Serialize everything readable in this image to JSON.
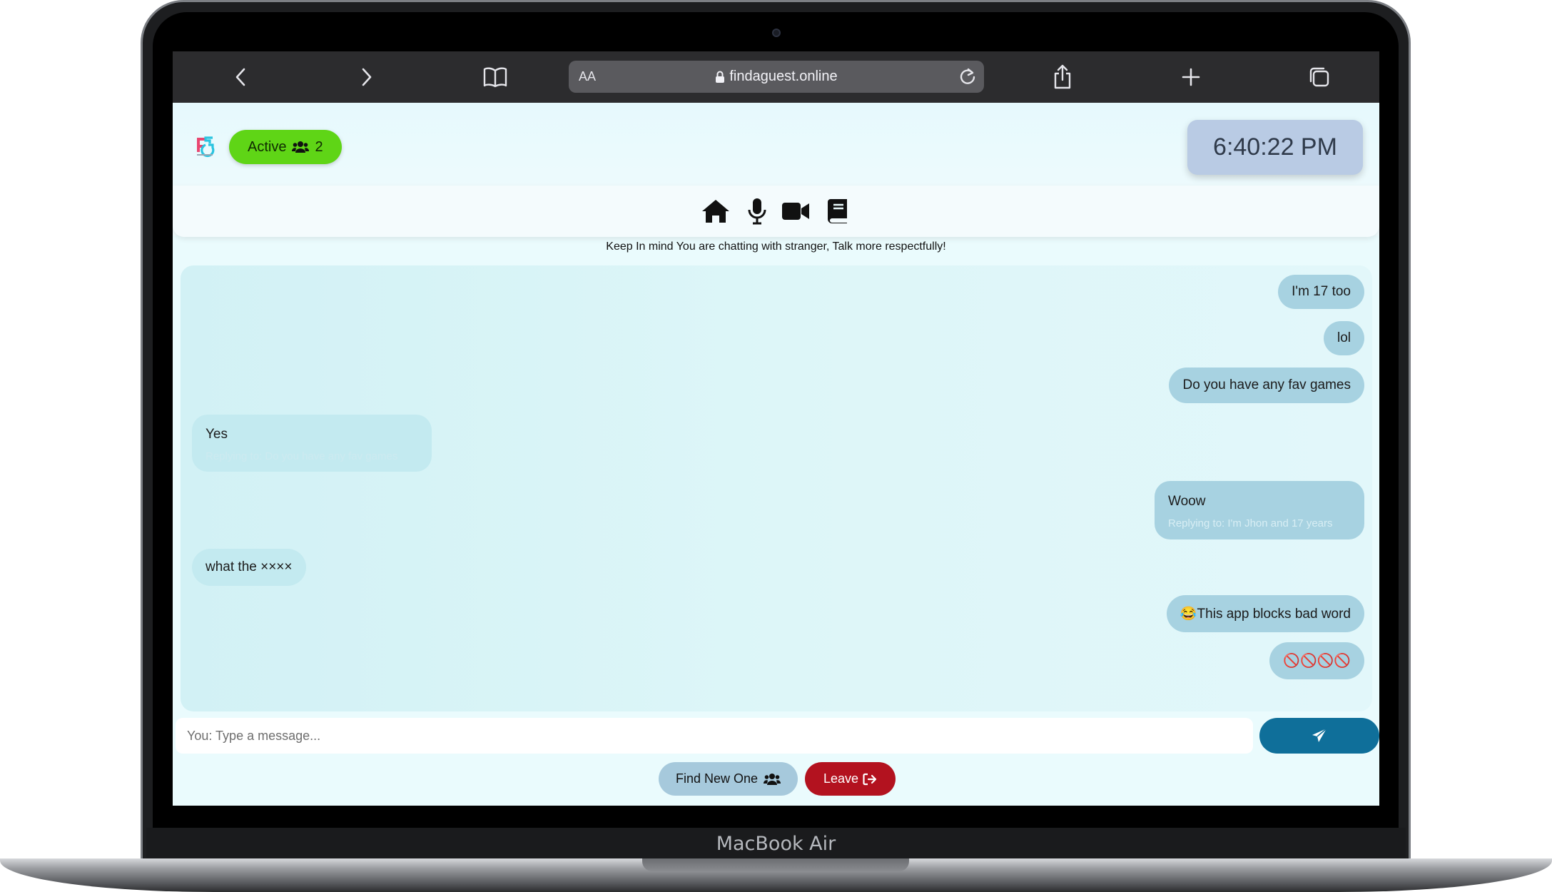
{
  "browser": {
    "aa_label": "AA",
    "url": "findaguest.online"
  },
  "app": {
    "active_label": "Active",
    "active_count": "2",
    "clock": "6:40:22 PM",
    "warning": "Keep In mind You are chatting with stranger, Talk more respectfully!"
  },
  "messages": [
    {
      "from": "me",
      "text": "I'm 17 too"
    },
    {
      "from": "me",
      "text": "lol"
    },
    {
      "from": "me",
      "text": "Do you have any fav games"
    },
    {
      "from": "stranger",
      "text": "Yes",
      "reply": "Replying to: Do you have any fav games"
    },
    {
      "from": "me",
      "text": "Woow",
      "reply": "Replying to: I'm Jhon and 17 years"
    },
    {
      "from": "stranger",
      "text": "what the ××××"
    },
    {
      "from": "me",
      "text": "😂This app blocks bad word"
    },
    {
      "from": "me",
      "text": "🚫🚫🚫🚫"
    }
  ],
  "composer": {
    "placeholder": "You: Type a message..."
  },
  "actions": {
    "find_label": "Find New One",
    "leave_label": "Leave"
  },
  "device": {
    "brand": "MacBook Air"
  },
  "colors": {
    "active": "#5fd516",
    "send": "#0f6f9a",
    "leave": "#b3121f",
    "my_bubble": "#a7d2e1",
    "their_bubble": "#c3eaf0"
  }
}
